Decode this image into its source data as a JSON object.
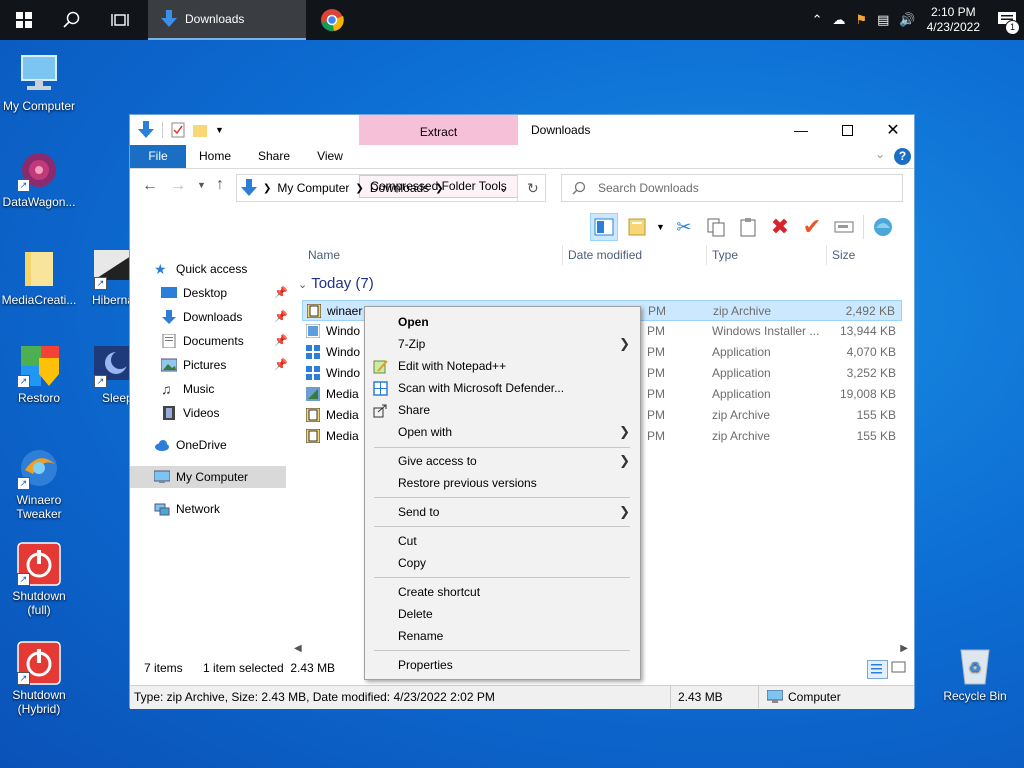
{
  "taskbar": {
    "task_label": "Downloads",
    "time": "2:10 PM",
    "date": "4/23/2022",
    "notification_count": "1"
  },
  "desktop_icons": [
    {
      "label": "My Computer"
    },
    {
      "label": "DataWagon..."
    },
    {
      "label": "MediaCreati..."
    },
    {
      "label": "Hiberna"
    },
    {
      "label": "Restoro"
    },
    {
      "label": "Sleep"
    },
    {
      "label": "Winaero Tweaker"
    },
    {
      "label": "Shutdown (full)"
    },
    {
      "label": "Shutdown (Hybrid)"
    },
    {
      "label": "Recycle Bin"
    }
  ],
  "window": {
    "title": "Downloads",
    "context_tab": "Extract",
    "context_subtab": "Compressed Folder Tools",
    "tabs": {
      "file": "File",
      "home": "Home",
      "share": "Share",
      "view": "View"
    },
    "breadcrumb": [
      "My Computer",
      "Downloads"
    ],
    "search_placeholder": "Search Downloads"
  },
  "nav": {
    "quick_access": "Quick access",
    "desktop": "Desktop",
    "downloads": "Downloads",
    "documents": "Documents",
    "pictures": "Pictures",
    "music": "Music",
    "videos": "Videos",
    "onedrive": "OneDrive",
    "my_computer": "My Computer",
    "network": "Network"
  },
  "columns": {
    "name": "Name",
    "date": "Date modified",
    "type": "Type",
    "size": "Size"
  },
  "group": "Today (7)",
  "files": [
    {
      "name": "winaer",
      "date": "PM",
      "type": "zip Archive",
      "size": "2,492 KB",
      "icon": "zip-icon"
    },
    {
      "name": "Windo",
      "date": "PM",
      "type": "Windows Installer ...",
      "size": "13,944 KB",
      "icon": "msi-icon"
    },
    {
      "name": "Windo",
      "date": "PM",
      "type": "Application",
      "size": "4,070 KB",
      "icon": "app-icon"
    },
    {
      "name": "Windo",
      "date": "PM",
      "type": "Application",
      "size": "3,252 KB",
      "icon": "app-icon"
    },
    {
      "name": "Media",
      "date": "PM",
      "type": "Application",
      "size": "19,008 KB",
      "icon": "app-icon"
    },
    {
      "name": "Media",
      "date": "PM",
      "type": "zip Archive",
      "size": "155 KB",
      "icon": "zip-icon"
    },
    {
      "name": "Media",
      "date": "PM",
      "type": "zip Archive",
      "size": "155 KB",
      "icon": "zip-icon"
    }
  ],
  "status": {
    "items": "7 items",
    "selected": "1 item selected  2.43 MB",
    "details": "Type: zip Archive, Size: 2.43 MB, Date modified: 4/23/2022 2:02 PM",
    "size": "2.43 MB",
    "location": "Computer"
  },
  "context_menu": {
    "open": "Open",
    "zip7": "7-Zip",
    "notepad": "Edit with Notepad++",
    "defender": "Scan with Microsoft Defender...",
    "share": "Share",
    "open_with": "Open with",
    "give_access": "Give access to",
    "restore": "Restore previous versions",
    "send_to": "Send to",
    "cut": "Cut",
    "copy": "Copy",
    "create_shortcut": "Create shortcut",
    "delete": "Delete",
    "rename": "Rename",
    "properties": "Properties"
  },
  "colors": {
    "accent": "#1a6fc4",
    "selection": "#cce8ff",
    "context_tab": "#f7c0d9"
  }
}
